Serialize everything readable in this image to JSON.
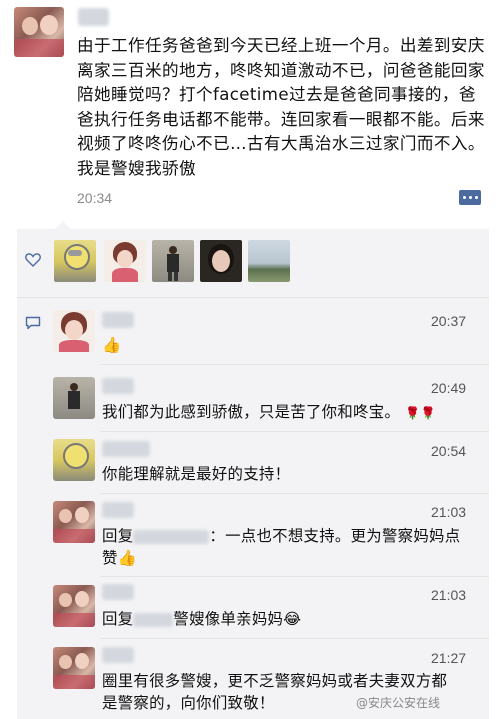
{
  "post": {
    "text": "由于工作任务爸爸到今天已经上班一个月。出差到安庆离家三百米的地方，咚咚知道激动不已，问爸爸能回家陪她睡觉吗？打个facetime过去是爸爸同事接的，爸爸执行任务电话都不能带。连回家看一眼都不能。后来视频了咚咚伤心不已…古有大禹治水三过家门而不入。我是警嫂我骄傲",
    "time": "20:34"
  },
  "comments": [
    {
      "time": "20:37",
      "text": "",
      "emoji": "👍"
    },
    {
      "time": "20:49",
      "text": "我们都为此感到骄傲，只是苦了你和咚宝。",
      "emoji": "🌹🌹"
    },
    {
      "time": "20:54",
      "text": "你能理解就是最好的支持！",
      "emoji": ""
    },
    {
      "time": "21:03",
      "text_prefix": "回复",
      "text": "：一点也不想支持。更为警察妈妈点赞",
      "emoji": "👍"
    },
    {
      "time": "21:03",
      "text_prefix": "回复",
      "text": "警嫂像单亲妈妈",
      "emoji": "😂"
    },
    {
      "time": "21:27",
      "text": "圈里有很多警嫂，更不乏警察妈妈或者夫妻双方都是警察的，向你们致敬！",
      "emoji": ""
    }
  ],
  "watermark": "@安庆公安在线",
  "icons": {
    "like": "heart-outline-icon",
    "comment": "comment-bubble-icon",
    "more": "more-dots-icon"
  },
  "colors": {
    "accent": "#4a6aa0",
    "panel": "#f3f3f5"
  }
}
